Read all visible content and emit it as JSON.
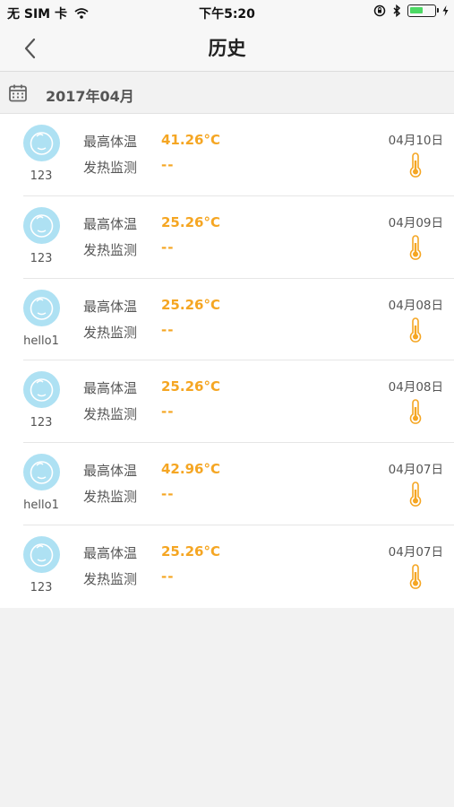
{
  "status_bar": {
    "carrier": "无 SIM 卡",
    "time": "下午5:20",
    "battery_level": 0.55,
    "icons": [
      "wifi-icon",
      "orientation-lock-icon",
      "bluetooth-icon",
      "battery-icon",
      "charging-icon"
    ]
  },
  "nav": {
    "title": "历史",
    "back_icon": "chevron-left-icon"
  },
  "month_header": {
    "label": "2017年04月",
    "icon": "calendar-icon"
  },
  "labels": {
    "max_temp": "最高体温",
    "fever_monitor": "发热监测"
  },
  "records": [
    {
      "user": "123",
      "max_temp": "41.26°C",
      "fever": "--",
      "date": "04月10日"
    },
    {
      "user": "123",
      "max_temp": "25.26°C",
      "fever": "--",
      "date": "04月09日"
    },
    {
      "user": "hello1",
      "max_temp": "25.26°C",
      "fever": "--",
      "date": "04月08日"
    },
    {
      "user": "123",
      "max_temp": "25.26°C",
      "fever": "--",
      "date": "04月08日"
    },
    {
      "user": "hello1",
      "max_temp": "42.96°C",
      "fever": "--",
      "date": "04月07日"
    },
    {
      "user": "123",
      "max_temp": "25.26°C",
      "fever": "--",
      "date": "04月07日"
    }
  ],
  "colors": {
    "accent": "#f5a623",
    "avatar": "#aee1f3",
    "background": "#f2f2f2"
  }
}
